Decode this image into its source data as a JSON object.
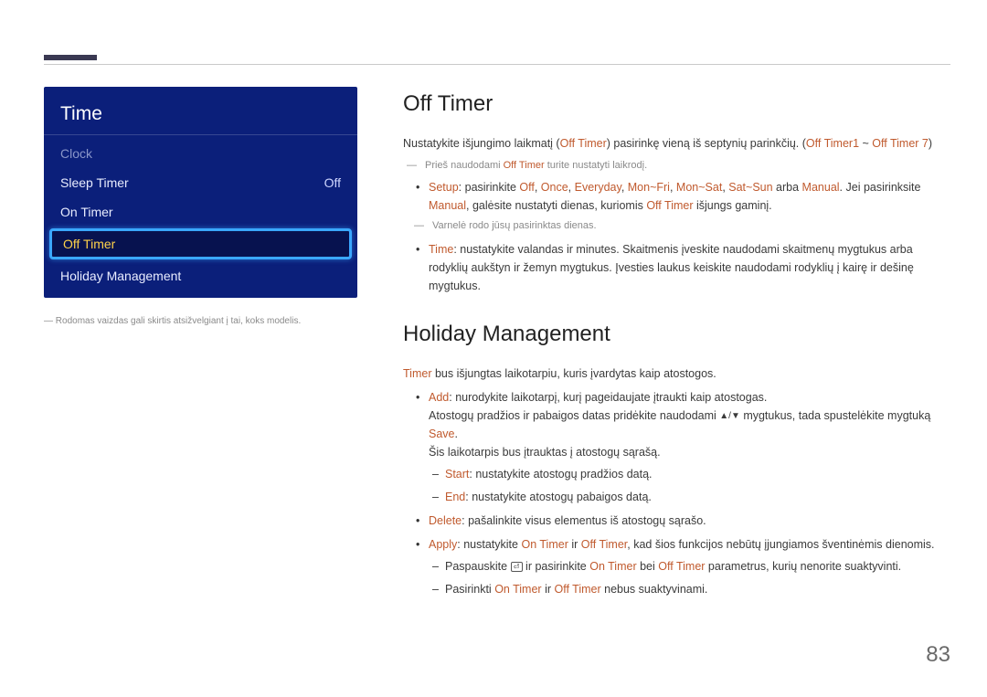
{
  "page_number": "83",
  "menu": {
    "title": "Time",
    "items": [
      {
        "label": "Clock",
        "value": "",
        "state": "disabled"
      },
      {
        "label": "Sleep Timer",
        "value": "Off",
        "state": "normal"
      },
      {
        "label": "On Timer",
        "value": "",
        "state": "normal"
      },
      {
        "label": "Off Timer",
        "value": "",
        "state": "selected"
      },
      {
        "label": "Holiday Management",
        "value": "",
        "state": "normal"
      }
    ]
  },
  "left_note": "Rodomas vaizdas gali skirtis atsižvelgiant į tai, koks modelis.",
  "section1": {
    "heading": "Off Timer",
    "intro_pre": "Nustatykite išjungimo laikmatį (",
    "intro_kw1": "Off Timer",
    "intro_mid": ") pasirinkę vieną iš septynių parinkčių. (",
    "intro_kw2": "Off Timer1",
    "intro_tilde": " ~ ",
    "intro_kw3": "Off Timer 7",
    "intro_post": ")",
    "note1_pre": "Prieš naudodami ",
    "note1_kw": "Off Timer",
    "note1_post": " turite nustatyti laikrodį.",
    "bullets": {
      "setup_kw": "Setup",
      "setup_pre": ": pasirinkite ",
      "setup_opts": [
        "Off",
        "Once",
        "Everyday",
        "Mon~Fri",
        "Mon~Sat",
        "Sat~Sun"
      ],
      "setup_or": " arba ",
      "setup_manual": "Manual",
      "setup_mid": ". Jei pasirinksite ",
      "setup_manual2": "Manual",
      "setup_post1": ", galėsite nustatyti dienas, kuriomis ",
      "setup_kw_off": "Off Timer",
      "setup_post2": " išjungs gaminį.",
      "note2": "Varnelė rodo jūsų pasirinktas dienas.",
      "time_kw": "Time",
      "time_text": ": nustatykite valandas ir minutes. Skaitmenis įveskite naudodami skaitmenų mygtukus arba rodyklių aukštyn ir žemyn mygtukus. Įvesties laukus keiskite naudodami rodyklių į kairę ir dešinę mygtukus."
    }
  },
  "section2": {
    "heading": "Holiday Management",
    "intro_kw": "Timer",
    "intro_text": " bus išjungtas laikotarpiu, kuris įvardytas kaip atostogos.",
    "add_kw": "Add",
    "add_text": ": nurodykite laikotarpį, kurį pageidaujate įtraukti kaip atostogas.",
    "add_line2_pre": "Atostogų pradžios ir pabaigos datas pridėkite naudodami ",
    "add_line2_mid": " mygtukus, tada spustelėkite mygtuką ",
    "add_line2_kw": "Save",
    "add_line2_post": ".",
    "add_line3": "Šis laikotarpis bus įtrauktas į atostogų sąrašą.",
    "start_kw": "Start",
    "start_text": ": nustatykite atostogų pradžios datą.",
    "end_kw": "End",
    "end_text": ": nustatykite atostogų pabaigos datą.",
    "delete_kw": "Delete",
    "delete_text": ": pašalinkite visus elementus iš atostogų sąrašo.",
    "apply_kw": "Apply",
    "apply_pre": ": nustatykite ",
    "apply_kw_on": "On Timer",
    "apply_and": " ir ",
    "apply_kw_off": "Off Timer",
    "apply_post": ", kad šios funkcijos nebūtų įjungiamos šventinėmis dienomis.",
    "apply_d1_pre": "Paspauskite ",
    "apply_d1_mid": " ir pasirinkite ",
    "apply_d1_kw_on": "On Timer",
    "apply_d1_bei": " bei ",
    "apply_d1_kw_off": "Off Timer",
    "apply_d1_post": " parametrus, kurių nenorite suaktyvinti.",
    "apply_d2_pre": "Pasirinkti ",
    "apply_d2_kw_on": "On Timer",
    "apply_d2_and": " ir ",
    "apply_d2_kw_off": "Off Timer",
    "apply_d2_post": " nebus suaktyvinami."
  }
}
